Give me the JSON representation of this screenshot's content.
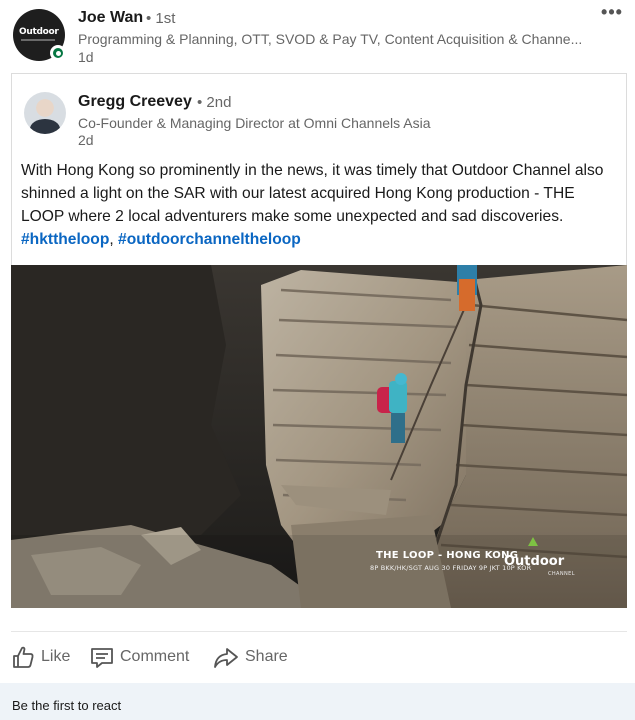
{
  "post": {
    "author": {
      "name": "Joe Wan",
      "degree": "• 1st",
      "headline": "Programming & Planning, OTT, SVOD & Pay TV, Content Acquisition & Channe...",
      "time": "1d",
      "avatar_text": "Outdoor"
    },
    "more_label": "•••"
  },
  "shared_post": {
    "author": {
      "name": "Gregg Creevey",
      "degree": "• 2nd",
      "headline": "Co-Founder & Managing Director at Omni Channels Asia",
      "time": "2d"
    },
    "text": "With Hong Kong so prominently in the news, it was timely that Outdoor Channel also shinned a light on the SAR with our latest acquired Hong Kong production - THE LOOP where 2 local adventurers make some unexpected and sad discoveries.",
    "hashtags": [
      "#hkttheloop",
      "#outdoorchanneltheloop"
    ],
    "hashtag_separator": ", "
  },
  "media": {
    "overlay_title": "THE LOOP - HONG KONG",
    "overlay_subtitle": "8P BKK/HK/SGT  AUG 30 FRIDAY  9P JKT  10P KOR",
    "brand": "Outdoor",
    "brand_sub": "CHANNEL",
    "icon": "mountain-logo-icon"
  },
  "actions": {
    "like_label": "Like",
    "comment_label": "Comment",
    "share_label": "Share"
  },
  "reactions": {
    "empty_text": "Be the first to react"
  },
  "colors": {
    "link": "#0a66c2",
    "muted": "#666666",
    "online": "#057642",
    "react_bar": "#eef3f8"
  }
}
